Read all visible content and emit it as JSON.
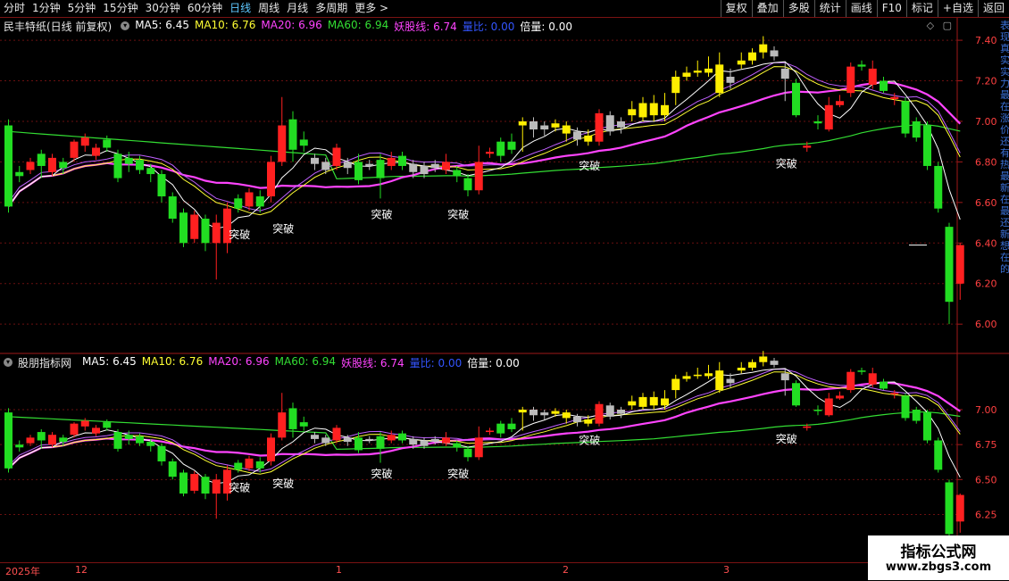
{
  "toolbar": {
    "periods": [
      "分时",
      "1分钟",
      "5分钟",
      "15分钟",
      "30分钟",
      "60分钟",
      "日线",
      "周线",
      "月线",
      "多周期",
      "更多 >"
    ],
    "active_period": "日线",
    "right_buttons": [
      "复权",
      "叠加",
      "多股",
      "统计",
      "画线",
      "F10",
      "标记",
      "+自选",
      "返回"
    ]
  },
  "top_panel": {
    "title": "民丰特纸(日线 前复权)",
    "indicators": [
      {
        "label": "MA5: 6.45",
        "color": "#ffffff"
      },
      {
        "label": "MA10: 6.76",
        "color": "#ffff33"
      },
      {
        "label": "MA20: 6.96",
        "color": "#ff44ff"
      },
      {
        "label": "MA60: 6.94",
        "color": "#33dd33"
      },
      {
        "label": "妖股线: 6.74",
        "color": "#ff44ff"
      },
      {
        "label": "量比: 0.00",
        "color": "#3355ff"
      },
      {
        "label": "倍量: 0.00",
        "color": "#ffffff"
      }
    ],
    "yticks": [
      "7.40",
      "7.20",
      "7.00",
      "6.80",
      "6.60",
      "6.40",
      "6.20",
      "6.00"
    ],
    "side_text": "表现真实实力最在涨价还有热最新在最还新想在的"
  },
  "bottom_panel": {
    "title": "股朋指标网",
    "indicators": [
      {
        "label": "MA5: 6.45",
        "color": "#ffffff"
      },
      {
        "label": "MA10: 6.76",
        "color": "#ffff33"
      },
      {
        "label": "MA20: 6.96",
        "color": "#ff44ff"
      },
      {
        "label": "MA60: 6.94",
        "color": "#33dd33"
      },
      {
        "label": "妖股线: 6.74",
        "color": "#ff44ff"
      },
      {
        "label": "量比: 0.00",
        "color": "#3355ff"
      },
      {
        "label": "倍量: 0.00",
        "color": "#ffffff"
      }
    ],
    "yticks": [
      "7.00",
      "6.75",
      "6.50",
      "6.25"
    ]
  },
  "signal_label": "突破",
  "date_axis": [
    "2025年",
    "12",
    "1",
    "2",
    "3"
  ],
  "watermark": {
    "line1": "指标公式网",
    "line2": "www.zbgs3.com"
  },
  "colors": {
    "up": "#ff2020",
    "down": "#22dd22",
    "yellow": "#ffee00",
    "gray": "#bbbbbb",
    "ma5": "#ffffff",
    "ma10": "#ffff33",
    "ma20": "#ff44ff",
    "ma60": "#33dd33",
    "grid": "#6a1010",
    "axis": "#a01818"
  },
  "chart_data": {
    "type": "candlestick",
    "candles": [
      [
        6.98,
        6.58,
        7.01,
        6.55
      ],
      [
        6.75,
        6.73,
        6.78,
        6.7
      ],
      [
        6.8,
        6.76,
        6.82,
        6.74
      ],
      [
        6.78,
        6.84,
        6.86,
        6.72
      ],
      [
        6.82,
        6.75,
        6.84,
        6.73
      ],
      [
        6.77,
        6.8,
        6.82,
        6.74
      ],
      [
        6.82,
        6.9,
        6.91,
        6.8
      ],
      [
        6.92,
        6.88,
        6.94,
        6.85
      ],
      [
        6.87,
        6.83,
        6.89,
        6.81
      ],
      [
        6.91,
        6.87,
        6.93,
        6.85
      ],
      [
        6.84,
        6.72,
        6.86,
        6.7
      ],
      [
        6.82,
        6.79,
        6.85,
        6.75
      ],
      [
        6.81,
        6.76,
        6.83,
        6.74
      ],
      [
        6.77,
        6.74,
        6.79,
        6.7
      ],
      [
        6.74,
        6.63,
        6.76,
        6.6
      ],
      [
        6.63,
        6.52,
        6.65,
        6.5
      ],
      [
        6.55,
        6.4,
        6.57,
        6.38
      ],
      [
        6.42,
        6.54,
        6.56,
        6.4
      ],
      [
        6.52,
        6.4,
        6.54,
        6.36
      ],
      [
        6.4,
        6.5,
        6.54,
        6.22
      ],
      [
        6.4,
        6.57,
        6.6,
        6.35
      ],
      [
        6.57,
        6.62,
        6.64,
        6.55
      ],
      [
        6.65,
        6.58,
        6.67,
        6.56
      ],
      [
        6.58,
        6.63,
        6.66,
        6.55
      ],
      [
        6.63,
        6.8,
        6.83,
        6.6
      ],
      [
        6.8,
        6.98,
        7.12,
        6.78
      ],
      [
        7.01,
        6.86,
        7.05,
        6.8
      ],
      [
        6.88,
        6.91,
        6.95,
        6.85
      ],
      [
        6.82,
        6.79,
        6.84,
        6.76
      ],
      [
        6.8,
        6.76,
        6.82,
        6.74
      ],
      [
        6.87,
        6.78,
        6.89,
        6.76
      ],
      [
        6.8,
        6.77,
        6.82,
        6.74
      ],
      [
        6.71,
        6.8,
        6.84,
        6.69
      ],
      [
        6.79,
        6.78,
        6.81,
        6.76
      ],
      [
        6.72,
        6.81,
        6.84,
        6.62
      ],
      [
        6.78,
        6.82,
        6.85,
        6.76
      ],
      [
        6.83,
        6.78,
        6.85,
        6.76
      ],
      [
        6.79,
        6.75,
        6.81,
        6.72
      ],
      [
        6.78,
        6.74,
        6.8,
        6.72
      ],
      [
        6.79,
        6.77,
        6.81,
        6.75
      ],
      [
        6.8,
        6.76,
        6.84,
        6.74
      ],
      [
        6.76,
        6.73,
        6.78,
        6.7
      ],
      [
        6.72,
        6.66,
        6.74,
        6.63
      ],
      [
        6.66,
        6.8,
        6.88,
        6.64
      ],
      [
        6.85,
        6.84,
        6.87,
        6.82
      ],
      [
        6.9,
        6.83,
        6.92,
        6.8
      ],
      [
        6.86,
        6.9,
        6.94,
        6.84
      ],
      [
        7.0,
        6.98,
        7.02,
        6.85
      ],
      [
        7.0,
        6.96,
        7.02,
        6.92
      ],
      [
        6.98,
        6.96,
        7.0,
        6.93
      ],
      [
        6.97,
        6.99,
        7.01,
        6.95
      ],
      [
        6.98,
        6.94,
        7.0,
        6.9
      ],
      [
        6.95,
        6.91,
        6.97,
        6.88
      ],
      [
        6.9,
        6.93,
        6.96,
        6.88
      ],
      [
        6.9,
        7.04,
        7.06,
        6.88
      ],
      [
        7.03,
        6.95,
        7.05,
        6.93
      ],
      [
        7.0,
        6.97,
        7.02,
        6.94
      ],
      [
        7.06,
        7.03,
        7.1,
        7.0
      ],
      [
        7.09,
        7.02,
        7.12,
        7.0
      ],
      [
        7.09,
        7.03,
        7.13,
        7.0
      ],
      [
        7.08,
        7.03,
        7.14,
        7.0
      ],
      [
        7.14,
        7.22,
        7.25,
        7.08
      ],
      [
        7.22,
        7.24,
        7.27,
        7.2
      ],
      [
        7.24,
        7.25,
        7.3,
        7.22
      ],
      [
        7.24,
        7.26,
        7.32,
        7.22
      ],
      [
        7.14,
        7.28,
        7.34,
        7.12
      ],
      [
        7.22,
        7.19,
        7.26,
        7.16
      ],
      [
        7.28,
        7.3,
        7.34,
        7.26
      ],
      [
        7.34,
        7.3,
        7.36,
        7.28
      ],
      [
        7.38,
        7.34,
        7.42,
        7.31
      ],
      [
        7.35,
        7.32,
        7.37,
        7.3
      ],
      [
        7.26,
        7.21,
        7.29,
        7.1
      ],
      [
        7.19,
        7.03,
        7.21,
        7.02
      ],
      [
        6.87,
        6.88,
        6.9,
        6.85
      ],
      [
        7.0,
        6.99,
        7.03,
        6.96
      ],
      [
        6.96,
        7.08,
        7.12,
        6.95
      ],
      [
        7.08,
        7.1,
        7.13,
        7.07
      ],
      [
        7.14,
        7.27,
        7.29,
        7.12
      ],
      [
        7.27,
        7.28,
        7.3,
        7.25
      ],
      [
        7.26,
        7.18,
        7.3,
        7.16
      ],
      [
        7.2,
        7.15,
        7.22,
        7.14
      ],
      [
        7.12,
        7.11,
        7.14,
        7.08
      ],
      [
        7.1,
        6.94,
        7.12,
        6.92
      ],
      [
        7.0,
        6.92,
        7.02,
        6.9
      ],
      [
        6.98,
        6.78,
        7.0,
        6.76
      ],
      [
        6.78,
        6.57,
        6.8,
        6.55
      ],
      [
        6.48,
        6.11,
        6.5,
        6.0
      ],
      [
        6.39,
        6.2,
        6.4,
        6.12
      ]
    ],
    "bar_colors": [
      "d",
      "d",
      "u",
      "d",
      "u",
      "d",
      "u",
      "u",
      "u",
      "d",
      "d",
      "d",
      "d",
      "d",
      "d",
      "d",
      "d",
      "u",
      "d",
      "u",
      "u",
      "d",
      "u",
      "d",
      "u",
      "u",
      "d",
      "d",
      "g",
      "g",
      "u",
      "g",
      "d",
      "g",
      "d",
      "u",
      "d",
      "g",
      "g",
      "g",
      "u",
      "d",
      "d",
      "u",
      "u",
      "d",
      "d",
      "y",
      "g",
      "g",
      "y",
      "y",
      "g",
      "y",
      "u",
      "g",
      "g",
      "y",
      "y",
      "y",
      "y",
      "y",
      "y",
      "y",
      "y",
      "y",
      "g",
      "y",
      "y",
      "y",
      "g",
      "g",
      "d",
      "u",
      "d",
      "u",
      "u",
      "u",
      "d",
      "u",
      "d",
      "u",
      "d",
      "d",
      "d",
      "d",
      "d",
      "u"
    ]
  }
}
